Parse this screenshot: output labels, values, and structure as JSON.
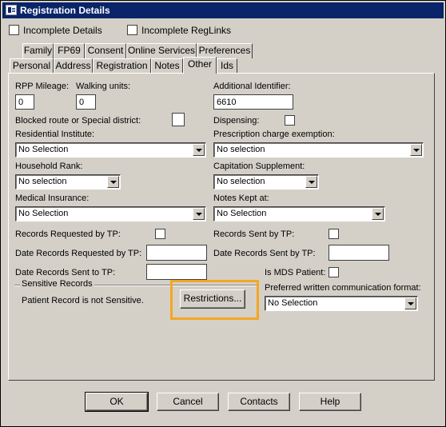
{
  "window": {
    "title": "Registration Details"
  },
  "top_checks": {
    "incomplete_details": "Incomplete Details",
    "incomplete_reglinks": "Incomplete RegLinks"
  },
  "tabs_back": [
    "Family",
    "FP69",
    "Consent",
    "Online Services",
    "Preferences"
  ],
  "tabs_front": [
    "Personal",
    "Address",
    "Registration",
    "Notes",
    "Other",
    "Ids"
  ],
  "active_tab": "Other",
  "fields": {
    "rpp_mileage_label": "RPP Mileage:",
    "rpp_mileage_value": "0",
    "walking_units_label": "Walking units:",
    "walking_units_value": "0",
    "additional_identifier_label": "Additional Identifier:",
    "additional_identifier_value": "6610",
    "blocked_route_label": "Blocked route or Special district:",
    "dispensing_label": "Dispensing:",
    "residential_institute_label": "Residential Institute:",
    "residential_institute_value": "No Selection",
    "prescription_charge_label": "Prescription charge exemption:",
    "prescription_charge_value": "No selection",
    "household_rank_label": "Household Rank:",
    "household_rank_value": "No selection",
    "capitation_supplement_label": "Capitation Supplement:",
    "capitation_supplement_value": "No selection",
    "medical_insurance_label": "Medical Insurance:",
    "medical_insurance_value": "No Selection",
    "notes_kept_at_label": "Notes Kept at:",
    "notes_kept_at_value": "No Selection",
    "records_requested_label": "Records Requested by TP:",
    "records_sent_label": "Records Sent by TP:",
    "date_records_requested_label": "Date Records Requested by TP:",
    "date_records_sent_by_label": "Date Records Sent by TP:",
    "date_records_sent_to_label": "Date Records Sent to TP:",
    "is_mds_label": "Is MDS Patient:",
    "preferred_comm_label": "Preferred written communication format:",
    "preferred_comm_value": "No Selection"
  },
  "sensitive": {
    "group_title": "Sensitive Records",
    "status_text": "Patient Record is not Sensitive.",
    "restrictions_button": "Restrictions..."
  },
  "buttons": {
    "ok": "OK",
    "cancel": "Cancel",
    "contacts": "Contacts",
    "help": "Help"
  },
  "colors": {
    "title_bar": "#0a246a",
    "dialog_bg": "#d4d0c8",
    "highlight": "#f5a623"
  }
}
